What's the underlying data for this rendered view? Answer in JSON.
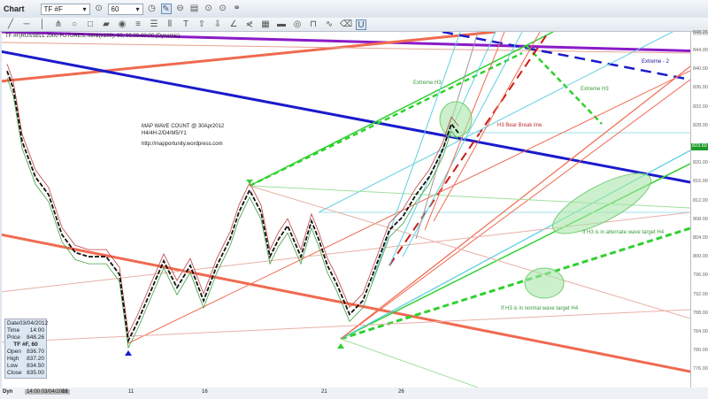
{
  "window": {
    "title": "Chart",
    "symbol": "TF #F",
    "interval": "60"
  },
  "chart_header": "TF #F|RUSSELL 2000 FUTURES, MINI(x100), 60, 00:00-00:00 (Dynamic)",
  "annotations": {
    "note_title": "MAP WAVE COUNT @ 30Apr2012",
    "note_sub": "H4/4H-2/D4/M5/Y1",
    "note_url": "http://mapportunity.wordpress.com",
    "extreme_h3_left": "Extreme H3",
    "extreme_h3_right": "Extreme H3",
    "extreme_2": "Extreme - 2",
    "bear_break": "H3 Bear Break line",
    "alt_target": "If H3 is in alternate wave target H4",
    "normal_target": "If H3 is in normal wave target H4"
  },
  "price_axis": {
    "ticks": [
      "844.00",
      "840.00",
      "836.00",
      "832.00",
      "828.00",
      "820.00",
      "816.00",
      "812.00",
      "808.00",
      "804.00",
      "800.00",
      "796.00",
      "792.00",
      "788.00",
      "784.00",
      "780.00",
      "776.00"
    ],
    "top_label": "848.26",
    "current": "823.60"
  },
  "info_box": {
    "date_label": "Date",
    "date": "03/04/2012",
    "time_label": "Time",
    "time": "14:00",
    "price_label": "Price",
    "price": "848.26",
    "instrument": "TF #F, 60",
    "open_label": "Open",
    "open": "836.70",
    "high_label": "High",
    "high": "837.20",
    "low_label": "Low",
    "low": "834.50",
    "close_label": "Close",
    "close": "835.00"
  },
  "x_axis": {
    "mode": "Dyn",
    "cursor": "14:00 03/04/2012",
    "labels": [
      "06",
      "11",
      "16",
      "21",
      "26"
    ]
  },
  "colors": {
    "price": "#111111",
    "blue_trend": "#1a1acc",
    "purple": "#8a1ac8",
    "red_channel": "#f06a50",
    "green": "#2fd02f"
  },
  "chart_data": {
    "type": "line",
    "series": [
      {
        "values": [
          839.8,
          836.1,
          824.8,
          817.2,
          813.4,
          804.9,
          801.1,
          800.2,
          800.2,
          796.4,
          782.3,
          786.1,
          792.7,
          799.3,
          793.6,
          798.3,
          790.8,
          798.3,
          804.0,
          809.7,
          814.4,
          809.7,
          800.2,
          804.0,
          806.8,
          800.2,
          807.8,
          804.0,
          798.3,
          794.6,
          787.9,
          790.8,
          798.3,
          805.9,
          808.7,
          813.4,
          817.2,
          822.9,
          828.5,
          826.6
        ]
      }
    ],
    "ylim": [
      774,
      848
    ]
  }
}
